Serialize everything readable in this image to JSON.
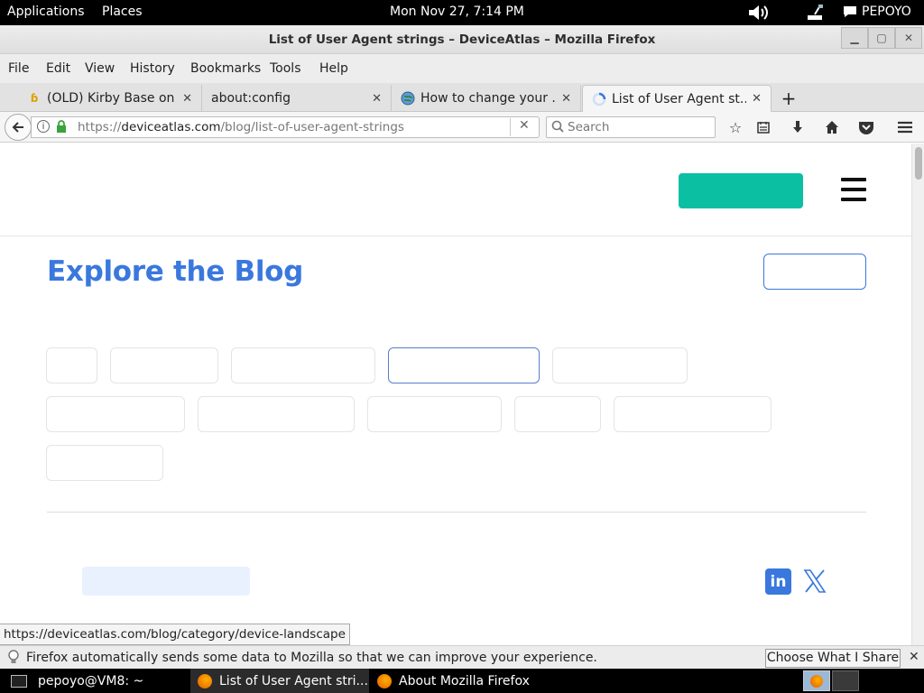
{
  "top_panel": {
    "applications": "Applications",
    "places": "Places",
    "clock": "Mon Nov 27,  7:14 PM",
    "user": "PEPOYO"
  },
  "window": {
    "title": "List of User Agent strings – DeviceAtlas – Mozilla Firefox"
  },
  "menu": [
    "File",
    "Edit",
    "View",
    "History",
    "Bookmarks",
    "Tools",
    "Help"
  ],
  "tabs": [
    {
      "label": "(OLD) Kirby Base on ..."
    },
    {
      "label": "about:config"
    },
    {
      "label": "How to change your ..."
    },
    {
      "label": "List of User Agent st..."
    }
  ],
  "navbar": {
    "url_scheme": "https://",
    "url_host": "deviceatlas.com",
    "url_path": "/blog/list-of-user-agent-strings",
    "search_placeholder": "Search"
  },
  "page": {
    "blog_title": "Explore the Blog",
    "colors": {
      "accent": "#3a78de",
      "cta": "#0bbfa3"
    }
  },
  "status_url": "https://deviceatlas.com/blog/category/device-landscape",
  "notification": {
    "text": "Firefox automatically sends some data to Mozilla so that we can improve your experience.",
    "button": "Choose What I Share"
  },
  "taskbar": [
    {
      "label": "pepoyo@VM8: ~"
    },
    {
      "label": "List of User Agent stri..."
    },
    {
      "label": "About Mozilla Firefox"
    }
  ]
}
